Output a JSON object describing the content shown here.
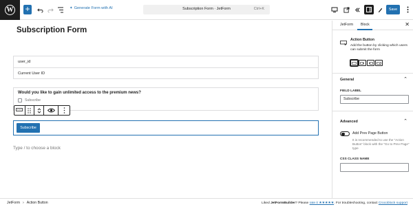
{
  "topbar": {
    "generate_form_label": "Generate Form with AI",
    "document_title": "Subscription Form · JetForm",
    "shortcut": "Ctrl+K",
    "save_label": "Save"
  },
  "canvas": {
    "title": "Subscription Form",
    "hidden_fields": [
      "user_id",
      "Current User ID"
    ],
    "question": "Would you like to gain unlimited access to the premium news?",
    "checkbox_option": "Subscribe",
    "subscribe_button": "Subscribe",
    "appender_placeholder": "Type / to choose a block"
  },
  "sidebar": {
    "tabs": [
      "JetForm",
      "Block"
    ],
    "active_tab": "Block",
    "block_name": "Action Button",
    "block_description": "Add the button by clicking which users can submit the form",
    "general_heading": "General",
    "field_label_caption": "FIELD LABEL",
    "field_label_value": "Subscribe",
    "advanced_heading": "Advanced",
    "prev_page_label": "Add Prev Page Button",
    "prev_page_help": "It is recommended to use the \"Action Button\" block with the \"Go to Prev Page\" type",
    "css_class_caption": "CSS CLASS NAME",
    "css_class_value": ""
  },
  "footer": {
    "breadcrumbs": [
      "JetForm",
      "Action Button"
    ],
    "note_prefix": "Liked ",
    "note_brand": "JetFormBuilder",
    "note_mid": "? Please ",
    "note_rate": "rate it ★★★★★",
    "note_trouble": ". For troubleshooting, contact ",
    "note_support": "Crocoblock support"
  },
  "colors": {
    "accent": "#2271b1",
    "dark": "#1e1e1e"
  }
}
